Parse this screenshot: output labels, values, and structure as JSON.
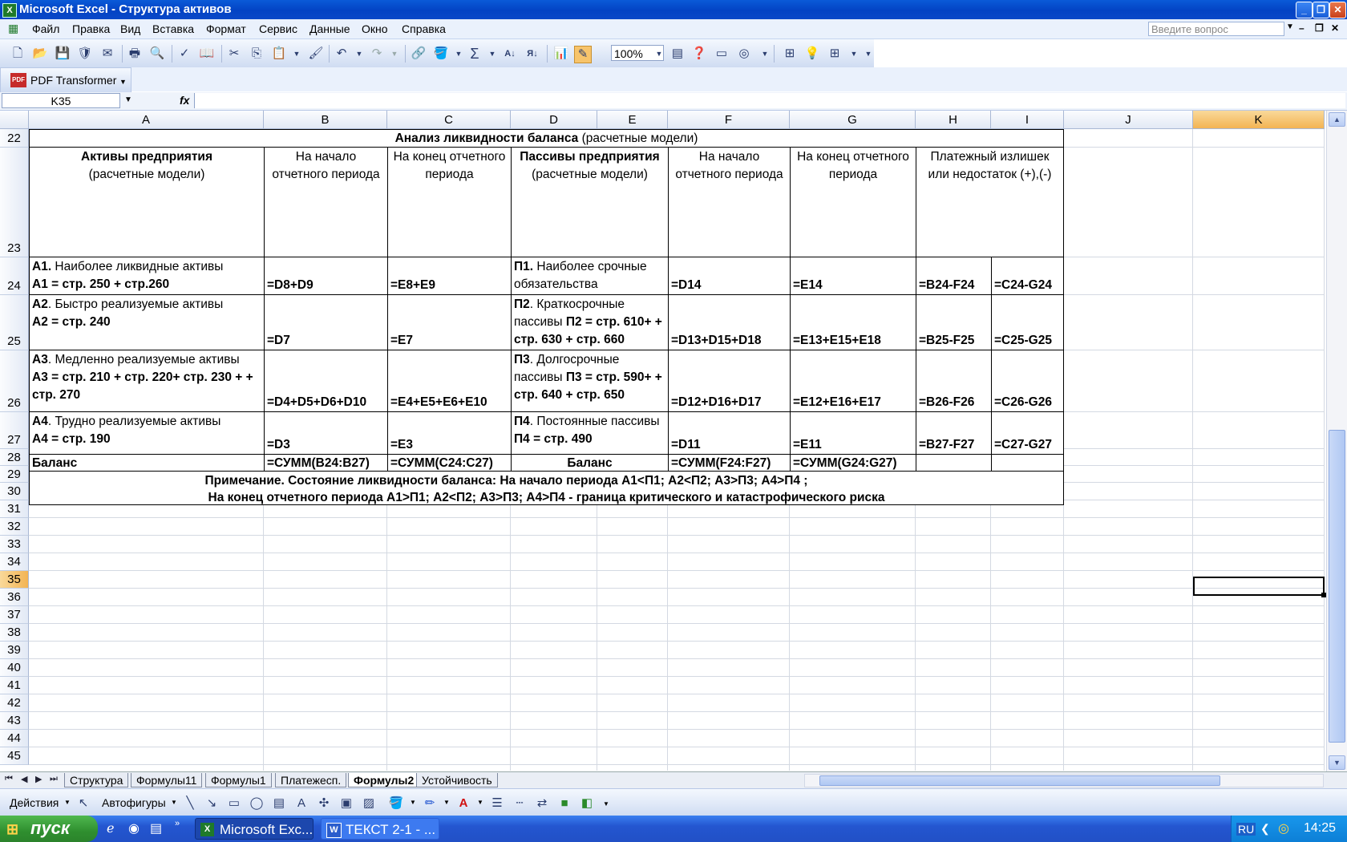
{
  "window": {
    "title": "Microsoft Excel - Структура активов"
  },
  "menu": {
    "items": [
      "Файл",
      "Правка",
      "Вид",
      "Вставка",
      "Формат",
      "Сервис",
      "Данные",
      "Окно",
      "Справка"
    ],
    "ask_placeholder": "Введите вопрос"
  },
  "toolbar": {
    "zoom": "100%"
  },
  "pdf_toolbar": {
    "icon": "PDF",
    "label": "PDF Transformer"
  },
  "formula_bar": {
    "name_box": "K35",
    "fx": "fx",
    "formula": ""
  },
  "columns": [
    "A",
    "B",
    "C",
    "D",
    "E",
    "F",
    "G",
    "H",
    "I",
    "J",
    "K"
  ],
  "selected_column": "K",
  "rows": [
    "22",
    "23",
    "24",
    "25",
    "26",
    "27",
    "28",
    "29",
    "30",
    "31",
    "32",
    "33",
    "34",
    "35",
    "36",
    "37",
    "38",
    "39",
    "40",
    "41",
    "42",
    "43",
    "44",
    "45"
  ],
  "selected_row": "35",
  "sheet": {
    "title_bold": "Анализ ликвидности баланса",
    "title_rest": " (расчетные модели)",
    "headers": {
      "assets_bold": "Активы  предприятия",
      "assets_sub": "(расчетные модели)",
      "start": "На начало отчетного периода",
      "end": "На конец отчетного периода",
      "liab_bold": "Пассивы предприятия",
      "liab_sub": "(расчетные модели)",
      "start2": "На начало отчетного периода",
      "end2": "На конец отчетного периода",
      "surplus": "Платежный излишек или недостаток (+),(-)"
    },
    "rows": [
      {
        "a_code": "А1.",
        "a_text": " Наиболее ликвидные активы",
        "a_formula": "А1 = стр. 250 + стр.260",
        "b": "=D8+D9",
        "c": "=E8+E9",
        "p_code": "П1.",
        "p_text": " Наиболее срочные обязательства",
        "p_formula": "",
        "f": "=D14",
        "g": "=E14",
        "h": "=B24-F24",
        "i": "=C24-G24"
      },
      {
        "a_code": "А2",
        "a_text": ". Быстро реализуемые активы",
        "a_formula": "А2 = стр. 240",
        "b": "=D7",
        "c": "=E7",
        "p_code": "П2",
        "p_text": ". Краткосрочные пассивы ",
        "p_formula": "П2 = стр. 610+ + стр. 630 + стр. 660",
        "f": "=D13+D15+D18",
        "g": "=E13+E15+E18",
        "h": "=B25-F25",
        "i": "=C25-G25"
      },
      {
        "a_code": "А3",
        "a_text": ". Медленно реализуемые активы",
        "a_formula": "А3 = стр. 210 + стр. 220+ стр. 230 + + стр. 270",
        "b": "=D4+D5+D6+D10",
        "c": "=E4+E5+E6+E10",
        "p_code": "П3",
        "p_text": ". Долгосрочные пассивы ",
        "p_formula": "П3 = стр. 590+ + стр. 640 + стр. 650",
        "f": "=D12+D16+D17",
        "g": "=E12+E16+E17",
        "h": "=B26-F26",
        "i": "=C26-G26"
      },
      {
        "a_code": "А4",
        "a_text": ". Трудно реализуемые активы",
        "a_formula": "А4 = стр. 190",
        "b": "=D3",
        "c": "=E3",
        "p_code": "П4",
        "p_text": ". Постоянные пассивы ",
        "p_formula": "П4 = стр. 490",
        "f": "=D11",
        "g": "=E11",
        "h": "=B27-F27",
        "i": "=C27-G27"
      }
    ],
    "balance": {
      "a": "Баланс",
      "b": "=СУММ(B24:B27)",
      "c": "=СУММ(C24:C27)",
      "de": "Баланс",
      "f": "=СУММ(F24:F27)",
      "g": "=СУММ(G24:G27)"
    },
    "note1": "Примечание. Состояние ликвидности баланса: На начало периода А1<П1; А2<П2; А3>П3; А4>П4 ;",
    "note2": "На конец отчетного периода А1>П1; А2<П2; А3>П3; А4>П4 -  граница критического и катастрофического риска"
  },
  "sheet_tabs": [
    "Структура",
    "Формулы11",
    "Формулы1",
    "Платежесп.",
    "Формулы2",
    "Устойчивость"
  ],
  "active_sheet": "Формулы2",
  "drawing_toolbar": {
    "actions": "Действия",
    "autoshapes": "Автофигуры"
  },
  "taskbar": {
    "start": "пуск",
    "buttons": [
      "Microsoft Exc...",
      "ТЕКСТ 2-1 - ..."
    ],
    "lang": "RU",
    "clock": "14:25"
  }
}
